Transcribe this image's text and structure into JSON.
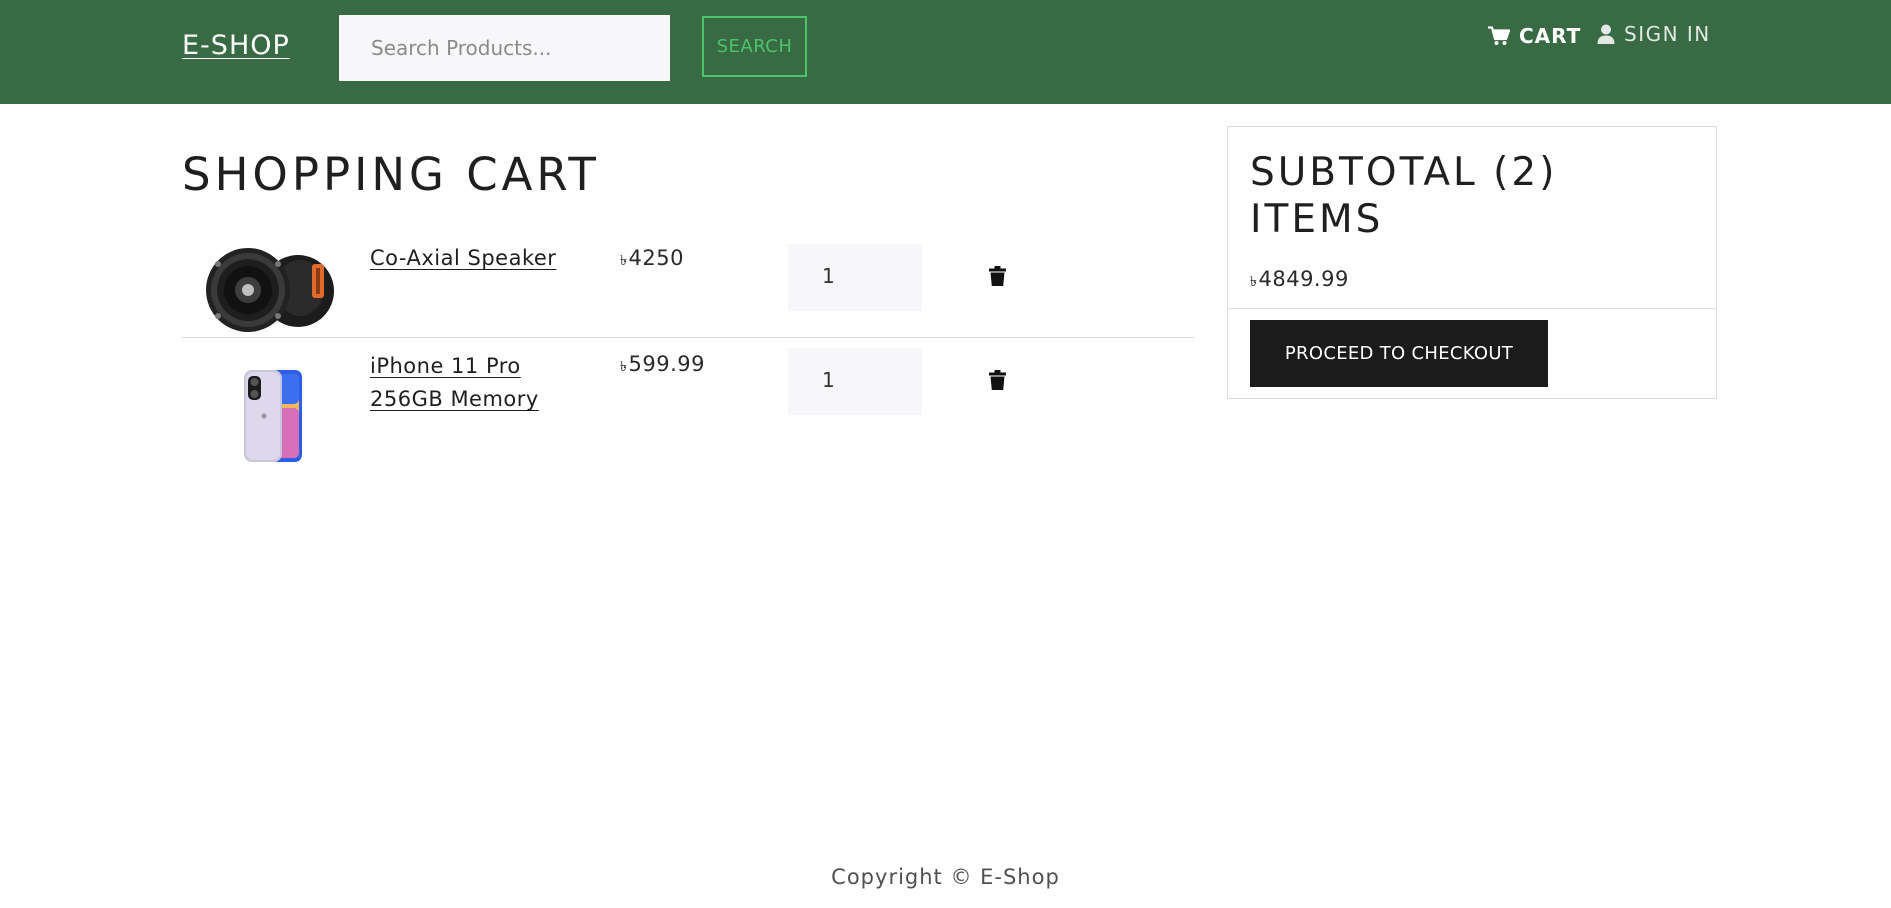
{
  "navbar": {
    "brand": "E-SHOP",
    "search_placeholder": "Search Products...",
    "search_label": "SEARCH",
    "cart_label": "CART",
    "signin_label": "SIGN IN",
    "background_color": "#386a43",
    "accent_color": "#4cc46a"
  },
  "cart": {
    "title": "SHOPPING CART",
    "items": [
      {
        "name": "Co-Axial Speaker",
        "currency_symbol": "৳",
        "price": "4250",
        "quantity": "1",
        "image_icon": "speaker-image",
        "delete_icon": "trash-icon"
      },
      {
        "name": "iPhone 11 Pro 256GB Memory",
        "currency_symbol": "৳",
        "price": "599.99",
        "quantity": "1",
        "image_icon": "phone-image",
        "delete_icon": "trash-icon"
      }
    ]
  },
  "summary": {
    "title": "SUBTOTAL (2) ITEMS",
    "currency_symbol": "৳",
    "total": "4849.99",
    "checkout_label": "PROCEED TO CHECKOUT",
    "checkout_color": "#1b1b1b"
  },
  "footer": {
    "copyright": "Copyright © E-Shop"
  }
}
